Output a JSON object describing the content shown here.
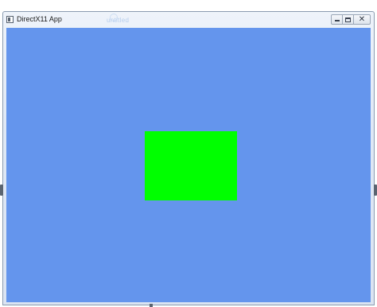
{
  "window": {
    "title": "DirectX11 App",
    "background_title": "untitled",
    "client_color": "#6495ed",
    "quad_color": "#00ff00",
    "icon": "app-window-icon"
  },
  "controls": {
    "minimize_icon": "minimize-icon",
    "maximize_icon": "maximize-icon",
    "close_icon": "close-icon",
    "close_glyph": "✕"
  }
}
